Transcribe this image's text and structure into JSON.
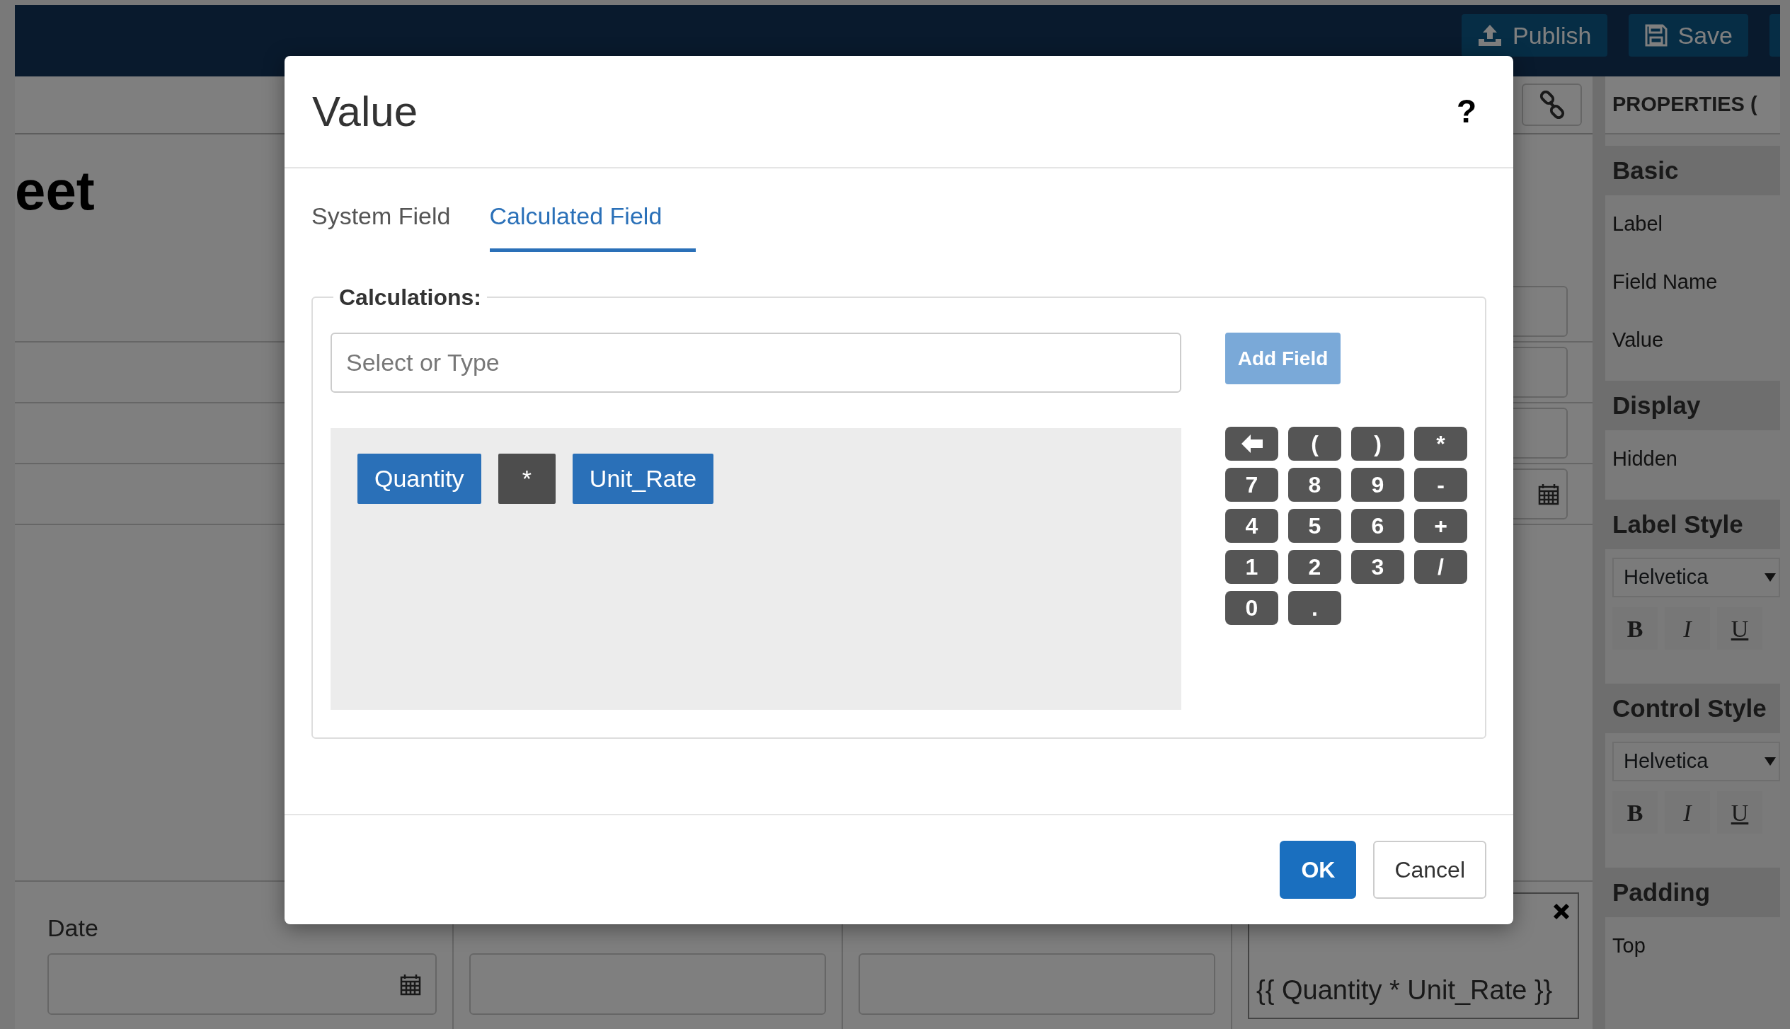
{
  "app_bar": {
    "buttons": [
      {
        "label": "Publish",
        "kind": "publish"
      },
      {
        "label": "Save",
        "kind": "save"
      }
    ]
  },
  "page_heading": "eet",
  "form_fields": [
    {
      "label": "Date",
      "kind": "date"
    },
    {
      "kind": "text"
    },
    {
      "kind": "text"
    },
    {
      "kind": "formula",
      "value": "{{ Quantity * Unit_Rate }}"
    }
  ],
  "properties": {
    "title": "PROPERTIES (",
    "sections": [
      {
        "title": "Basic",
        "items": [
          {
            "kind": "label",
            "text": "Label"
          },
          {
            "kind": "label",
            "text": "Field Name"
          },
          {
            "kind": "label",
            "text": "Value"
          }
        ]
      },
      {
        "title": "Display",
        "items": [
          {
            "kind": "label",
            "text": "Hidden"
          }
        ]
      },
      {
        "title": "Label Style",
        "items": [
          {
            "kind": "select",
            "text": "Helvetica"
          },
          {
            "kind": "styles",
            "labels": [
              "B",
              "I",
              "U"
            ]
          }
        ]
      },
      {
        "title": "Control Style",
        "items": [
          {
            "kind": "select",
            "text": "Helvetica"
          },
          {
            "kind": "styles",
            "labels": [
              "B",
              "I",
              "U"
            ]
          }
        ]
      },
      {
        "title": "Padding",
        "items": [
          {
            "kind": "label",
            "text": "Top"
          }
        ]
      }
    ]
  },
  "dialog": {
    "title": "Value",
    "help": "?",
    "tabs": [
      {
        "label": "System Field",
        "selected": false
      },
      {
        "label": "Calculated Field",
        "selected": true
      }
    ],
    "legend": "Calculations:",
    "input": {
      "placeholder": "Select or Type"
    },
    "add_button": {
      "label": "Add Field",
      "disabled": true
    },
    "tokens": [
      {
        "text": "Quantity",
        "kind": "field"
      },
      {
        "text": "*",
        "kind": "operator"
      },
      {
        "text": "Unit_Rate",
        "kind": "field"
      }
    ],
    "keypad": [
      {
        "kind": "backspace"
      },
      {
        "kind": "char",
        "label": "("
      },
      {
        "kind": "char",
        "label": ")"
      },
      {
        "kind": "char",
        "label": "*"
      },
      {
        "kind": "char",
        "label": "7"
      },
      {
        "kind": "char",
        "label": "8"
      },
      {
        "kind": "char",
        "label": "9"
      },
      {
        "kind": "char",
        "label": "-"
      },
      {
        "kind": "char",
        "label": "4"
      },
      {
        "kind": "char",
        "label": "5"
      },
      {
        "kind": "char",
        "label": "6"
      },
      {
        "kind": "char",
        "label": "+"
      },
      {
        "kind": "char",
        "label": "1"
      },
      {
        "kind": "char",
        "label": "2"
      },
      {
        "kind": "char",
        "label": "3"
      },
      {
        "kind": "char",
        "label": "/"
      },
      {
        "kind": "char",
        "label": "0"
      },
      {
        "kind": "char",
        "label": "."
      }
    ],
    "buttons": [
      {
        "label": "OK",
        "kind": "primary"
      },
      {
        "label": "Cancel",
        "kind": "secondary"
      }
    ]
  }
}
